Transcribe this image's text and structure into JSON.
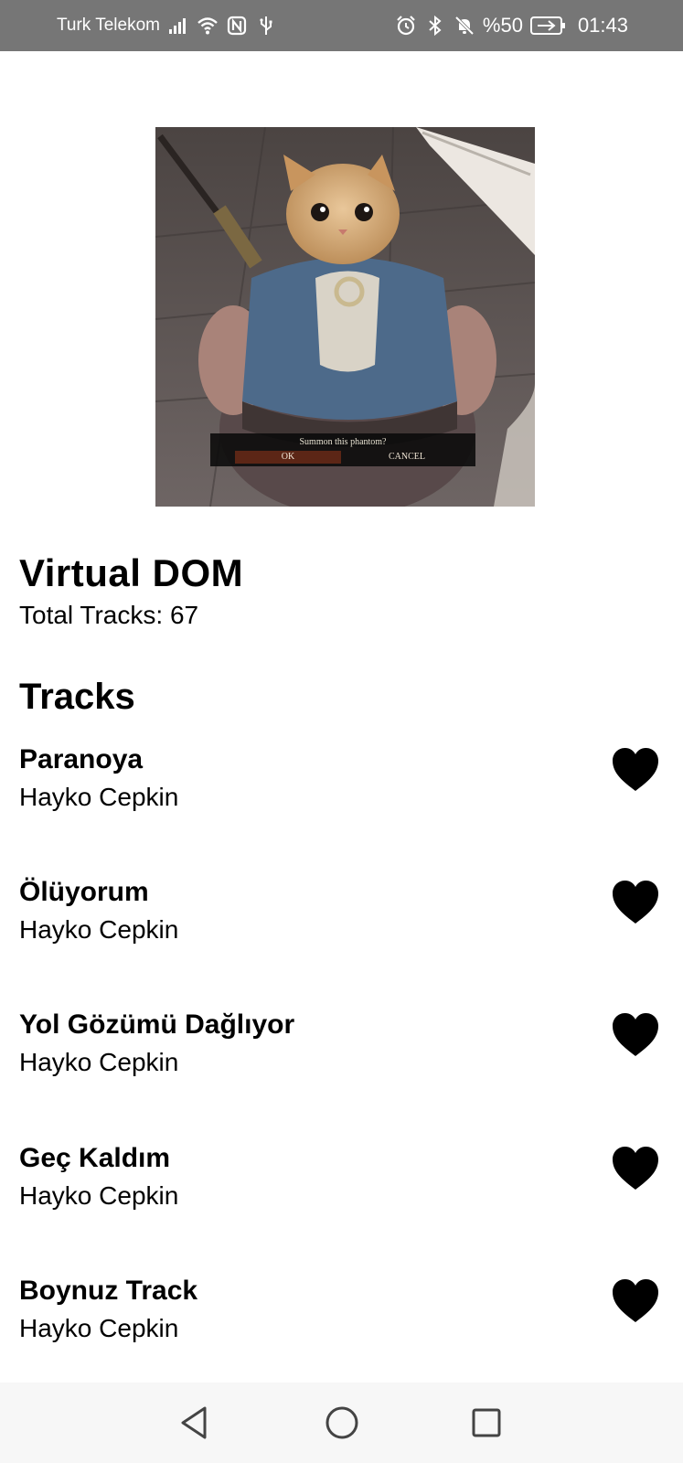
{
  "status_bar": {
    "carrier": "Turk Telekom",
    "battery": "%50",
    "time": "01:43",
    "icons_left": [
      "signal-icon",
      "wifi-icon",
      "nfc-icon",
      "usb-icon"
    ],
    "icons_right": [
      "alarm-icon",
      "bluetooth-icon",
      "mute-icon",
      "battery-charging-icon"
    ]
  },
  "album_art": {
    "dialog_prompt": "Summon this phantom?",
    "dialog_ok": "OK",
    "dialog_cancel": "CANCEL"
  },
  "playlist": {
    "title": "Virtual DOM",
    "total_label": "Total Tracks:",
    "total_count": "67"
  },
  "tracks_section": {
    "title": "Tracks"
  },
  "tracks": [
    {
      "name": "Paranoya",
      "artist": "Hayko Cepkin",
      "liked": true
    },
    {
      "name": "Ölüyorum",
      "artist": "Hayko Cepkin",
      "liked": true
    },
    {
      "name": "Yol Gözümü Dağlıyor",
      "artist": "Hayko Cepkin",
      "liked": true
    },
    {
      "name": "Geç Kaldım",
      "artist": "Hayko Cepkin",
      "liked": true
    },
    {
      "name": "Boynuz Track",
      "artist": "Hayko Cepkin",
      "liked": true
    }
  ],
  "nav": {
    "buttons": [
      "back-icon",
      "home-icon",
      "recents-icon"
    ]
  },
  "colors": {
    "status_bar_bg": "#767676",
    "nav_bar_bg": "#f7f7f7",
    "heart": "#000000"
  }
}
